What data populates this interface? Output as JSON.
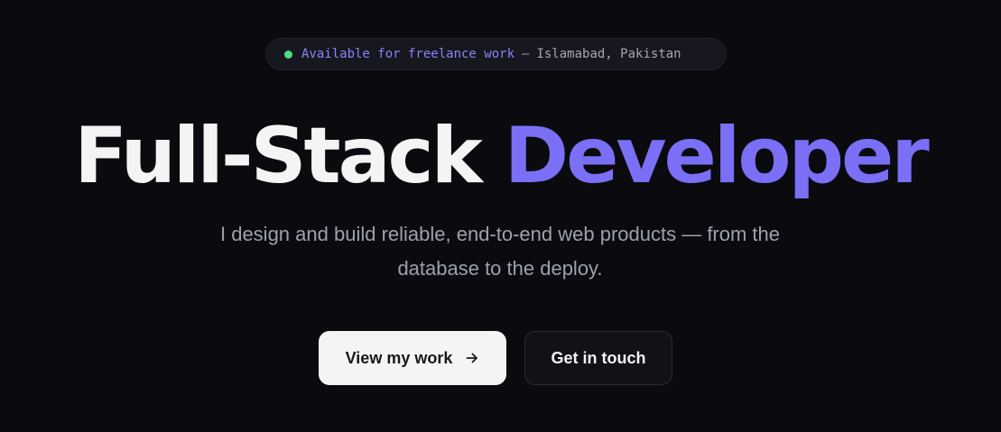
{
  "badge": {
    "availability": "Available for freelance work",
    "separator": "—",
    "location": "Islamabad, Pakistan",
    "status_color": "#4ade80"
  },
  "hero": {
    "title_part1": "Full-Stack",
    "title_part2": "Developer",
    "subtitle_line1": "I design and build reliable, end-to-end web products — from the",
    "subtitle_line2": "database to the deploy."
  },
  "actions": {
    "primary_label": "View my work",
    "primary_icon": "arrow-right-icon",
    "secondary_label": "Get in touch"
  },
  "colors": {
    "background": "#0b0b0f",
    "accent": "#7a6ff5",
    "text": "#f4f4f5",
    "muted": "#9ca0ae"
  }
}
